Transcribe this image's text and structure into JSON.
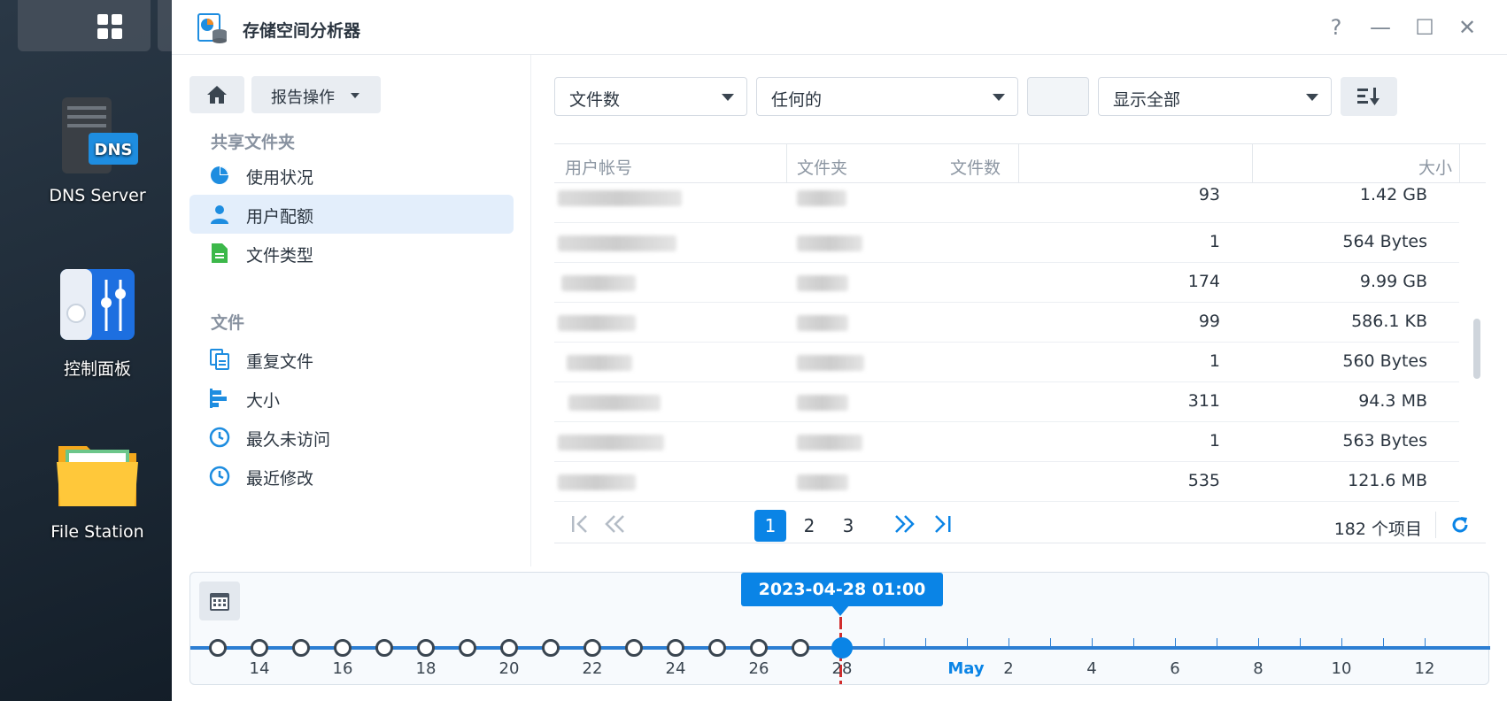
{
  "desktop": {
    "apps": [
      {
        "label": "DNS Server",
        "icon": "dns-server-icon"
      },
      {
        "label": "控制面板",
        "icon": "control-panel-icon"
      },
      {
        "label": "File Station",
        "icon": "file-station-icon"
      }
    ],
    "dns_badge": "DNS"
  },
  "window": {
    "title": "存储空间分析器",
    "controls": {
      "help": "?",
      "minimize": "—",
      "maximize": "☐",
      "close": "✕"
    }
  },
  "sidebar": {
    "home_icon": "home-icon",
    "report_button": "报告操作",
    "section_shared": "共享文件夹",
    "shared_items": [
      {
        "label": "使用状况",
        "icon": "pie-chart-icon"
      },
      {
        "label": "用户配额",
        "icon": "user-icon",
        "active": true
      },
      {
        "label": "文件类型",
        "icon": "document-icon"
      }
    ],
    "section_files": "文件",
    "file_items": [
      {
        "label": "重复文件",
        "icon": "duplicate-icon"
      },
      {
        "label": "大小",
        "icon": "bar-size-icon"
      },
      {
        "label": "最久未访问",
        "icon": "clock-icon"
      },
      {
        "label": "最近修改",
        "icon": "clock-icon"
      }
    ]
  },
  "filters": {
    "metric": "文件数",
    "condition": "任何的",
    "value_input": "",
    "display": "显示全部"
  },
  "table": {
    "columns": [
      "用户帐号",
      "文件夹",
      "文件数",
      "大小"
    ],
    "rows": [
      {
        "count": "93",
        "size": "1.42 GB"
      },
      {
        "count": "1",
        "size": "564 Bytes"
      },
      {
        "count": "174",
        "size": "9.99 GB"
      },
      {
        "count": "99",
        "size": "586.1 KB"
      },
      {
        "count": "1",
        "size": "560 Bytes"
      },
      {
        "count": "311",
        "size": "94.3 MB"
      },
      {
        "count": "1",
        "size": "563 Bytes"
      },
      {
        "count": "535",
        "size": "121.6 MB"
      }
    ]
  },
  "pager": {
    "pages": [
      "1",
      "2",
      "3"
    ],
    "current": "1",
    "total": "182 个项目"
  },
  "timeline": {
    "current_label": "2023-04-28 01:00",
    "labels": [
      "14",
      "16",
      "18",
      "20",
      "22",
      "24",
      "26",
      "28",
      "May",
      "2",
      "4",
      "6",
      "8",
      "10",
      "12"
    ]
  },
  "colors": {
    "accent": "#0a84e6",
    "marker": "#d12d2d"
  }
}
